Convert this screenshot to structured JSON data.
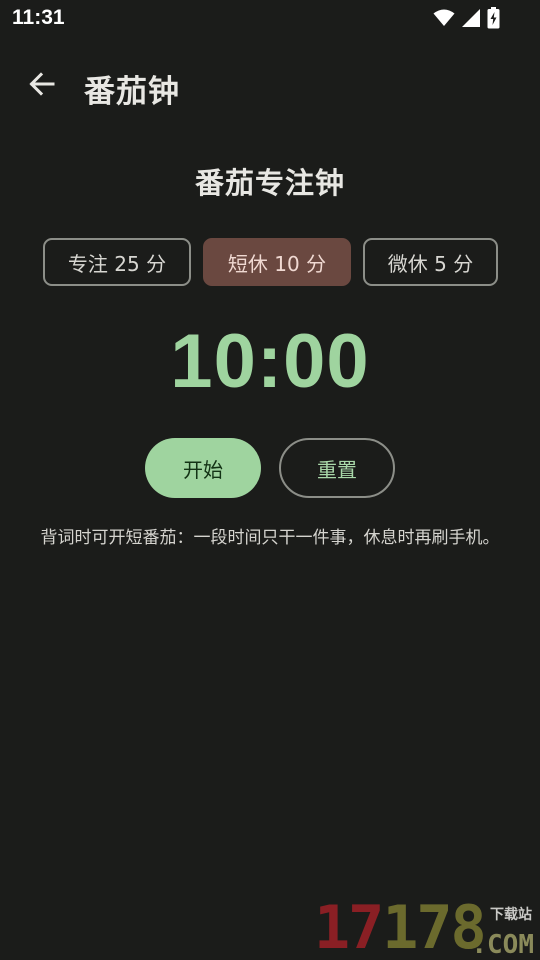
{
  "status_bar": {
    "time": "11:31",
    "icons": [
      "wifi-icon",
      "cellular-signal-icon",
      "battery-charging-icon"
    ]
  },
  "app_bar": {
    "back_icon": "arrow-left-icon",
    "title": "番茄钟"
  },
  "main": {
    "heading": "番茄专注钟",
    "modes": [
      {
        "label": "专注 25 分",
        "selected": false
      },
      {
        "label": "短休 10 分",
        "selected": true
      },
      {
        "label": "微休 5 分",
        "selected": false
      }
    ],
    "timer": "10:00",
    "start_label": "开始",
    "reset_label": "重置",
    "tip": "背词时可开短番茄：一段时间只干一件事，休息时再刷手机。"
  },
  "watermark": {
    "number_a": "17",
    "number_b": "178",
    "tag": "下载站",
    "domain": ".COM"
  },
  "colors": {
    "background": "#1b1c1a",
    "accent_green": "#9fd49f",
    "selected_chip": "#6a4840",
    "outline": "#8c8e88"
  }
}
